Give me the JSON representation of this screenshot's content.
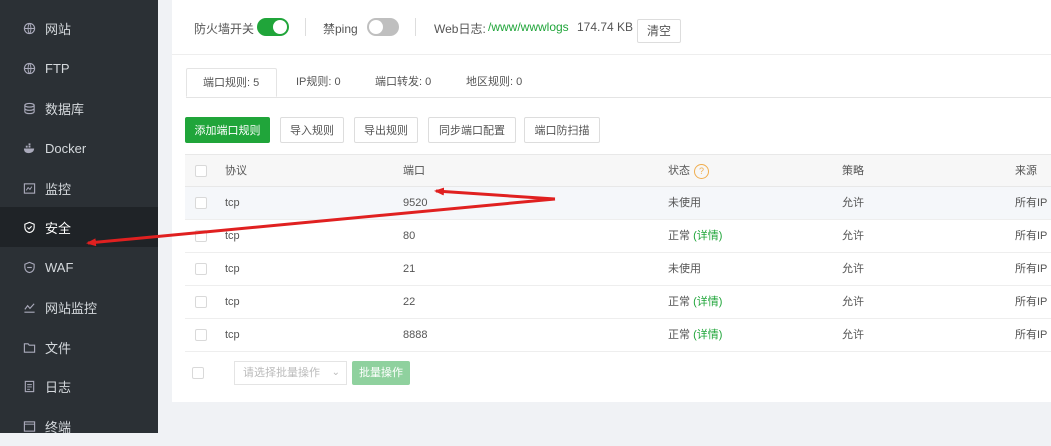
{
  "sidebar": {
    "items": [
      {
        "label": "网站",
        "icon": "globe-icon"
      },
      {
        "label": "FTP",
        "icon": "globe-icon"
      },
      {
        "label": "数据库",
        "icon": "database-icon"
      },
      {
        "label": "Docker",
        "icon": "docker-icon"
      },
      {
        "label": "监控",
        "icon": "monitor-icon"
      },
      {
        "label": "安全",
        "icon": "shield-icon",
        "active": true
      },
      {
        "label": "WAF",
        "icon": "waf-shield-icon"
      },
      {
        "label": "网站监控",
        "icon": "chart-line-icon"
      },
      {
        "label": "文件",
        "icon": "folder-icon"
      },
      {
        "label": "日志",
        "icon": "log-icon"
      },
      {
        "label": "终端",
        "icon": "terminal-icon"
      }
    ]
  },
  "topbar": {
    "firewall_label": "防火墙开关",
    "firewall_on": true,
    "ping_label": "禁ping",
    "ping_on": false,
    "weblog_label": "Web日志:",
    "weblog_path": "/www/wwwlogs",
    "weblog_size": "174.74 KB",
    "clear_label": "清空"
  },
  "tabs": [
    {
      "label": "端口规则: 5",
      "active": true
    },
    {
      "label": "IP规则: 0"
    },
    {
      "label": "端口转发: 0"
    },
    {
      "label": "地区规则: 0"
    }
  ],
  "actions": {
    "add": "添加端口规则",
    "import": "导入规则",
    "export": "导出规则",
    "sync": "同步端口配置",
    "antiscan": "端口防扫描"
  },
  "table": {
    "headers": {
      "protocol": "协议",
      "port": "端口",
      "status": "状态",
      "strategy": "策略",
      "source": "来源"
    },
    "rows": [
      {
        "protocol": "tcp",
        "port": "9520",
        "status": "未使用",
        "detail": "",
        "strategy": "允许",
        "source": "所有IP"
      },
      {
        "protocol": "tcp",
        "port": "80",
        "status": "正常",
        "detail": "(详情)",
        "strategy": "允许",
        "source": "所有IP"
      },
      {
        "protocol": "tcp",
        "port": "21",
        "status": "未使用",
        "detail": "",
        "strategy": "允许",
        "source": "所有IP"
      },
      {
        "protocol": "tcp",
        "port": "22",
        "status": "正常",
        "detail": "(详情)",
        "strategy": "允许",
        "source": "所有IP"
      },
      {
        "protocol": "tcp",
        "port": "8888",
        "status": "正常",
        "detail": "(详情)",
        "strategy": "允许",
        "source": "所有IP"
      }
    ]
  },
  "bottom": {
    "select_placeholder": "请选择批量操作",
    "batch_label": "批量操作"
  },
  "colors": {
    "accent": "#20a53a",
    "sidebar_bg": "#2b3035",
    "annotation": "#e02020"
  }
}
